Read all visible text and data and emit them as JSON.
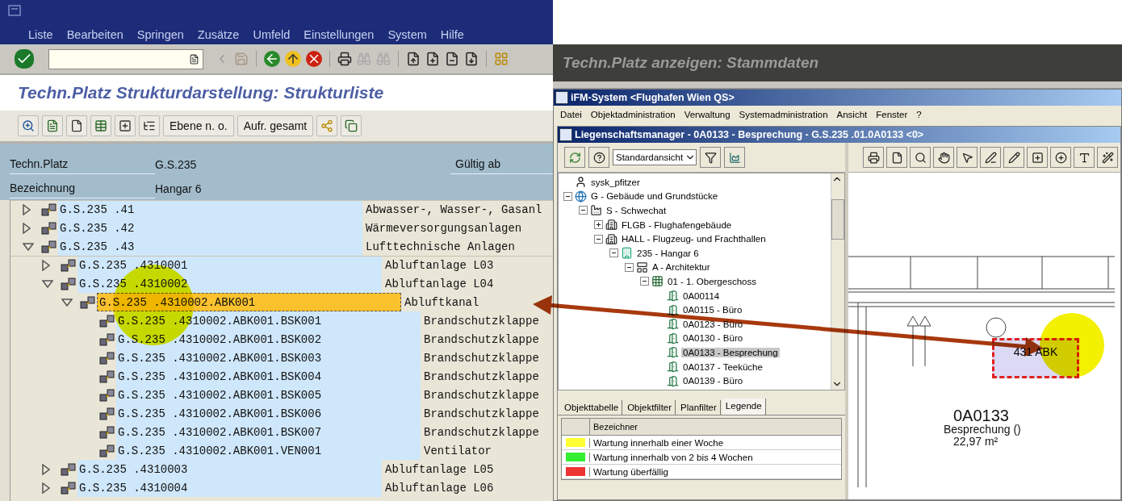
{
  "sap": {
    "menu": [
      "Liste",
      "Bearbeiten",
      "Springen",
      "Zusätze",
      "Umfeld",
      "Einstellungen",
      "System",
      "Hilfe"
    ],
    "title": "Techn.Platz Strukturdarstellung: Strukturliste",
    "app_buttons": [
      "Ebene n. o.",
      "Aufr. gesamt"
    ],
    "header_fields": [
      {
        "label": "Techn.Platz",
        "value": "G.S.235"
      },
      {
        "label": "Bezeichnung",
        "value": "Hangar 6"
      }
    ],
    "valid_from_label": "Gültig ab",
    "tree": [
      {
        "code": "G.S.235 .41",
        "text": "Abwasser-, Wasser-, Gasanl",
        "expanded": false,
        "selected": false
      },
      {
        "code": "G.S.235 .42",
        "text": "Wärmeversorgungsanlagen",
        "expanded": false,
        "selected": false
      },
      {
        "code": "G.S.235 .43",
        "text": "Lufttechnische Anlagen",
        "expanded": true,
        "selected": false,
        "children": [
          {
            "code": "G.S.235 .4310001",
            "text": "Abluftanlage L03",
            "expanded": false,
            "selected": false
          },
          {
            "code": "G.S.235 .4310002",
            "text": "Abluftanlage L04",
            "expanded": true,
            "selected": false,
            "children": [
              {
                "code": "G.S.235 .4310002.ABK001",
                "text": "Abluftkanal",
                "expanded": true,
                "selected": true,
                "children": [
                  {
                    "code": "G.S.235 .4310002.ABK001.BSK001",
                    "text": "Brandschutzklappe",
                    "selected": false
                  },
                  {
                    "code": "G.S.235 .4310002.ABK001.BSK002",
                    "text": "Brandschutzklappe",
                    "selected": false
                  },
                  {
                    "code": "G.S.235 .4310002.ABK001.BSK003",
                    "text": "Brandschutzklappe",
                    "selected": false
                  },
                  {
                    "code": "G.S.235 .4310002.ABK001.BSK004",
                    "text": "Brandschutzklappe",
                    "selected": false
                  },
                  {
                    "code": "G.S.235 .4310002.ABK001.BSK005",
                    "text": "Brandschutzklappe",
                    "selected": false
                  },
                  {
                    "code": "G.S.235 .4310002.ABK001.BSK006",
                    "text": "Brandschutzklappe",
                    "selected": false
                  },
                  {
                    "code": "G.S.235 .4310002.ABK001.BSK007",
                    "text": "Brandschutzklappe",
                    "selected": false
                  },
                  {
                    "code": "G.S.235 .4310002.ABK001.VEN001",
                    "text": "Ventilator",
                    "selected": false
                  }
                ]
              }
            ]
          },
          {
            "code": "G.S.235 .4310003",
            "text": "Abluftanlage L05",
            "expanded": false,
            "selected": false
          },
          {
            "code": "G.S.235 .4310004",
            "text": "Abluftanlage L06",
            "expanded": false,
            "selected": false
          }
        ]
      }
    ]
  },
  "background_window": {
    "title": "Techn.Platz anzeigen: Stammdaten"
  },
  "ifm": {
    "title": "iFM-System <Flughafen Wien QS>",
    "menu": [
      "Datei",
      "Objektadministration",
      "Verwaltung",
      "Systemadministration",
      "Ansicht",
      "Fenster",
      "?"
    ],
    "inner_title": "Liegenschaftsmanager - 0A0133 - Besprechung - G.S.235 .01.0A0133 <0>",
    "view_select": "Standardansicht",
    "tree": [
      {
        "kind": "user",
        "label": "sysk_pfitzer",
        "selected": false
      },
      {
        "kind": "globe",
        "label": "G - Gebäude und Grundstücke",
        "expanded": true,
        "selected": false,
        "children": [
          {
            "kind": "site",
            "label": "S - Schwechat",
            "expanded": true,
            "selected": false,
            "children": [
              {
                "kind": "building",
                "label": "FLGB - Flughafengebäude",
                "expanded": false,
                "selected": false
              },
              {
                "kind": "building",
                "label": "HALL - Flugzeug- und Frachthallen",
                "expanded": true,
                "selected": false,
                "children": [
                  {
                    "kind": "hangar",
                    "label": "235 - Hangar 6",
                    "expanded": true,
                    "selected": false,
                    "children": [
                      {
                        "kind": "discipline",
                        "label": "A - Architektur",
                        "expanded": true,
                        "selected": false,
                        "children": [
                          {
                            "kind": "floor",
                            "label": "01 - 1. Obergeschoss",
                            "expanded": true,
                            "selected": false,
                            "children": [
                              {
                                "kind": "room",
                                "label": "0A00114",
                                "selected": false
                              },
                              {
                                "kind": "room",
                                "label": "0A0115 - Büro",
                                "selected": false
                              },
                              {
                                "kind": "room",
                                "label": "0A0123 - Büro",
                                "selected": false
                              },
                              {
                                "kind": "room",
                                "label": "0A0130 - Büro",
                                "selected": false
                              },
                              {
                                "kind": "room",
                                "label": "0A0133 - Besprechung",
                                "selected": true
                              },
                              {
                                "kind": "room",
                                "label": "0A0137 - Teeküche",
                                "selected": false
                              },
                              {
                                "kind": "room",
                                "label": "0A0139 - Büro",
                                "selected": false
                              }
                            ]
                          }
                        ]
                      }
                    ]
                  }
                ]
              }
            ]
          }
        ]
      }
    ],
    "tabs": [
      {
        "label": "Objekttabelle",
        "selected": false
      },
      {
        "label": "Objektfilter",
        "selected": false
      },
      {
        "label": "Planfilter",
        "selected": false
      },
      {
        "label": "Legende",
        "selected": true
      }
    ],
    "legend": {
      "column": "Bezeichner",
      "rows": [
        {
          "label": "Wartung innerhalb einer Woche",
          "color": "#ffff33"
        },
        {
          "label": "Wartung innerhalb von 2 bis 4 Wochen",
          "color": "#33ee33"
        },
        {
          "label": "Wartung überfällig",
          "color": "#ee3333"
        }
      ]
    },
    "plan": {
      "symbol_label": "431 ABK",
      "room_number": "0A0133",
      "room_name": "Besprechung ()",
      "room_area": "22,97 m²"
    }
  }
}
